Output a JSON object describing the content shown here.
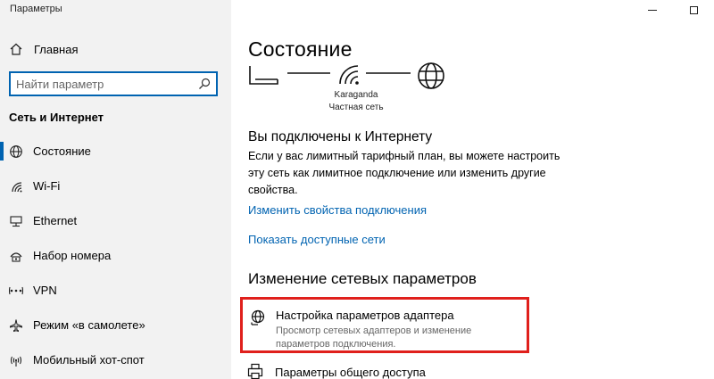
{
  "window": {
    "title": "Параметры"
  },
  "sidebar": {
    "home_label": "Главная",
    "search_placeholder": "Найти параметр",
    "section_heading": "Сеть и Интернет",
    "items": [
      {
        "label": "Состояние",
        "icon": "globe-status-icon",
        "active": true
      },
      {
        "label": "Wi-Fi",
        "icon": "wifi-icon",
        "active": false
      },
      {
        "label": "Ethernet",
        "icon": "ethernet-icon",
        "active": false
      },
      {
        "label": "Набор номера",
        "icon": "dialup-icon",
        "active": false
      },
      {
        "label": "VPN",
        "icon": "vpn-icon",
        "active": false
      },
      {
        "label": "Режим «в самолете»",
        "icon": "airplane-icon",
        "active": false
      },
      {
        "label": "Мобильный хот-спот",
        "icon": "hotspot-icon",
        "active": false
      }
    ]
  },
  "main": {
    "title": "Состояние",
    "network": {
      "name": "Karaganda",
      "type": "Частная сеть"
    },
    "status_heading": "Вы подключены к Интернету",
    "status_description": "Если у вас лимитный тарифный план, вы можете настроить эту сеть как лимитное подключение или изменить другие свойства.",
    "links": [
      "Изменить свойства подключения",
      "Показать доступные сети"
    ],
    "change_heading": "Изменение сетевых параметров",
    "adapter_option": {
      "title": "Настройка параметров адаптера",
      "description": "Просмотр сетевых адаптеров и изменение параметров подключения."
    },
    "sharing_option": {
      "title": "Параметры общего доступа"
    }
  },
  "colors": {
    "accent": "#0063b1",
    "highlight": "#e0201c",
    "sidebar_bg": "#f2f2f2"
  }
}
